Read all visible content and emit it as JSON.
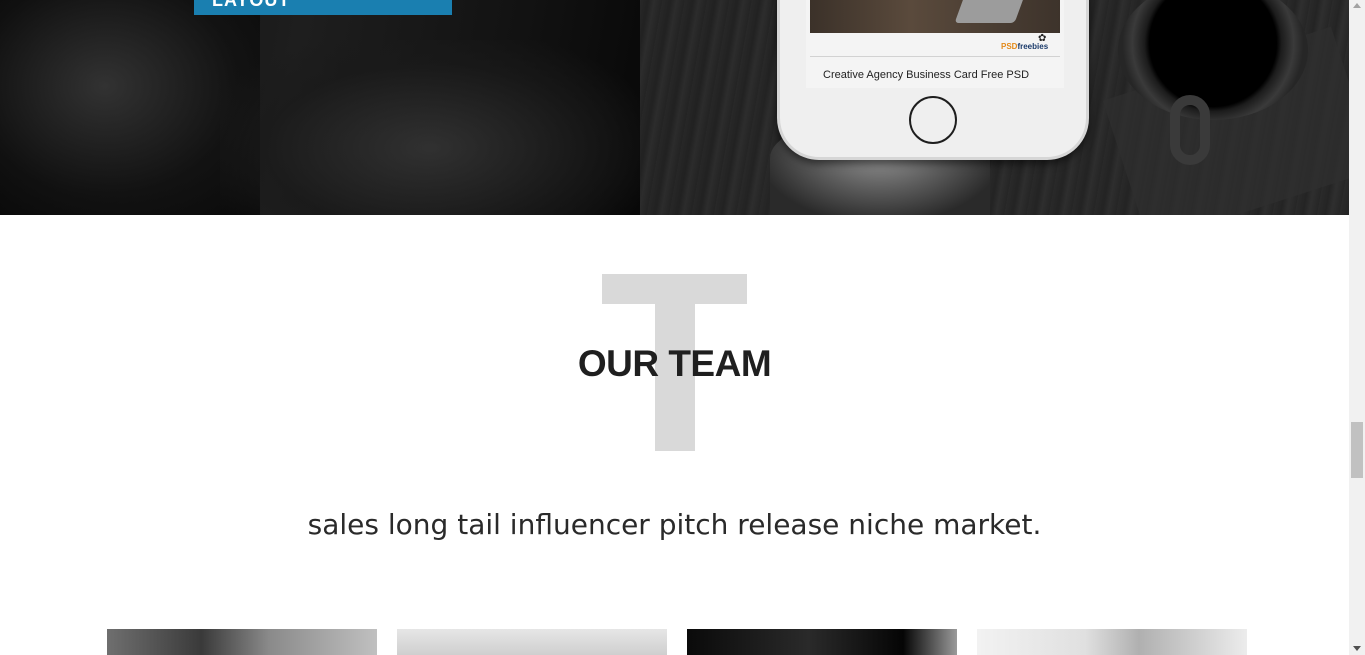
{
  "hero": {
    "button_label": "LAYOUT",
    "phone": {
      "logo_psd": "PSD",
      "logo_freebies": "freebies",
      "caption": "Creative Agency Business Card Free PSD"
    }
  },
  "team": {
    "title": "OUR TEAM",
    "watermark_letter": "T",
    "subtitle": "sales long tail influencer pitch release niche market.",
    "members_visible": 4
  },
  "colors": {
    "accent": "#1a7fb0",
    "watermark": "#d9d9d9",
    "title_text": "#1f1f1f"
  },
  "icons": {
    "home_button": "phone-home-button-icon",
    "scroll_up": "arrow-up-icon",
    "scroll_down": "arrow-down-icon"
  }
}
